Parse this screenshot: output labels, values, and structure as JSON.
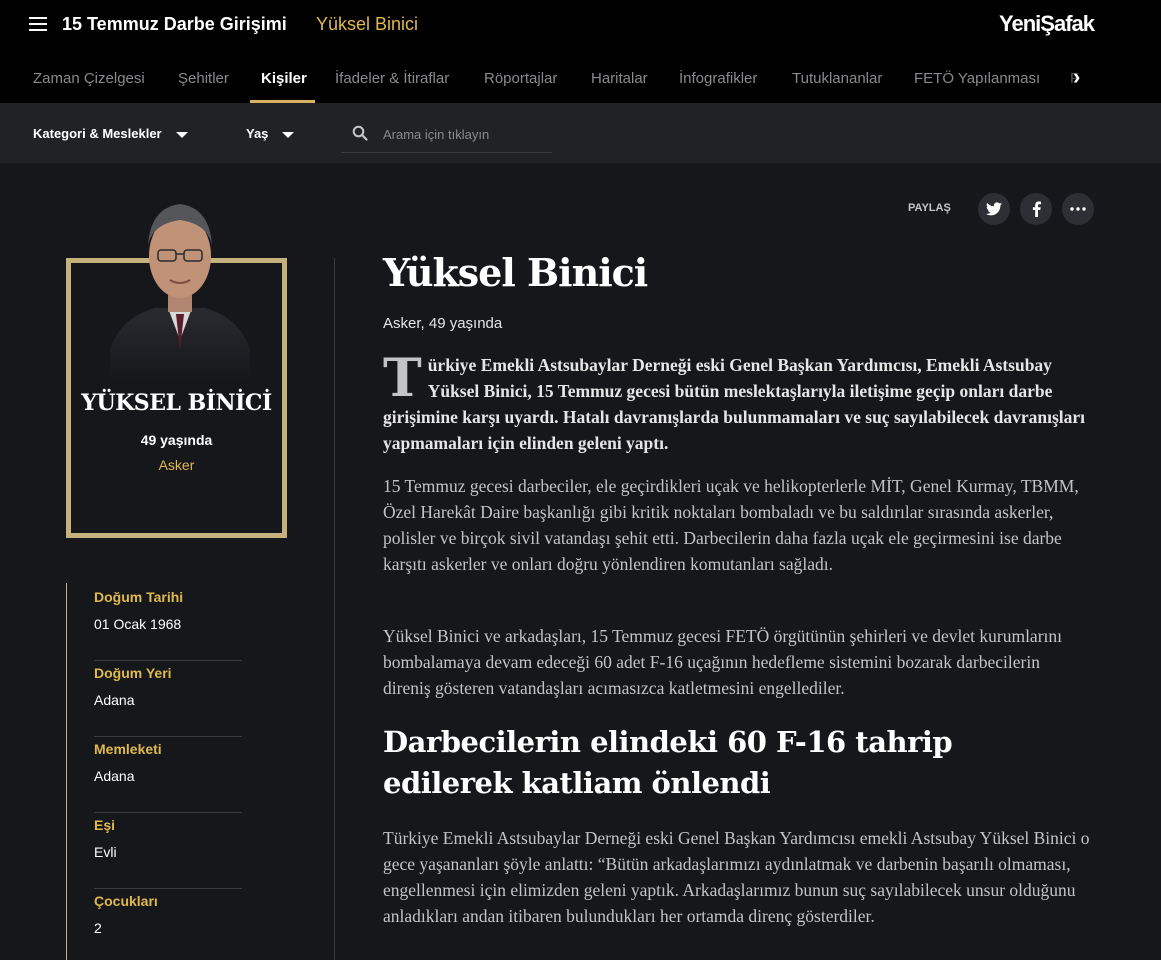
{
  "header": {
    "title": "15 Temmuz Darbe Girişimi",
    "subtitle": "Yüksel Binici",
    "logo": "YeniŞafak"
  },
  "nav": {
    "items": [
      "Zaman Çizelgesi",
      "Şehitler",
      "Kişiler",
      "İfadeler & İtiraflar",
      "Röportajlar",
      "Haritalar",
      "İnfografikler",
      "Tutuklananlar",
      "FETÖ Yapılanması",
      "F"
    ],
    "active": "Kişiler"
  },
  "filters": {
    "category": "Kategori & Meslekler",
    "age": "Yaş",
    "search_placeholder": "Arama için tıklayın"
  },
  "share": {
    "label": "PAYLAŞ"
  },
  "profile": {
    "name": "YÜKSEL BİNİCİ",
    "age": "49 yaşında",
    "job": "Asker",
    "facts": [
      {
        "label": "Doğum Tarihi",
        "value": "01 Ocak 1968"
      },
      {
        "label": "Doğum Yeri",
        "value": "Adana"
      },
      {
        "label": "Memleketi",
        "value": "Adana"
      },
      {
        "label": "Eşi",
        "value": "Evli"
      },
      {
        "label": "Çocukları",
        "value": "2"
      }
    ]
  },
  "article": {
    "title": "Yüksel Binici",
    "meta": "Asker, 49 yaşında",
    "dropcap": "T",
    "lead": "ürkiye Emekli Astsubaylar Derneği eski Genel Başkan Yardımcısı, Emekli Astsubay Yüksel Binici, 15 Temmuz gecesi bütün meslektaşlarıyla iletişime geçip onları darbe girişimine karşı uyardı. Hatalı davranışlarda bulunmamaları ve suç sayılabilecek davranışları yapmamaları için elinden geleni yaptı.",
    "p1": "15 Temmuz gecesi darbeciler, ele geçirdikleri uçak ve helikopterlerle MİT, Genel Kurmay, TBMM, Özel Harekât Daire başkanlığı gibi kritik noktaları bombaladı ve bu saldırılar sırasında askerler, polisler ve birçok sivil vatandaşı şehit etti. Darbecilerin daha fazla uçak ele geçirmesini ise darbe karşıtı askerler ve onları doğru yönlendiren komutanları sağladı.",
    "p2": "Yüksel Binici ve arkadaşları, 15 Temmuz gecesi FETÖ örgütünün şehirleri ve devlet kurumlarını bombalamaya devam edeceği 60 adet F-16 uçağının hedefleme sistemini bozarak darbecilerin direniş gösteren vatandaşları acımasızca katletmesini engellediler.",
    "subheading": "Darbecilerin elindeki 60 F-16 tahrip edilerek katliam önlendi",
    "p3": "Türkiye Emekli Astsubaylar Derneği eski Genel Başkan Yardımcısı emekli Astsubay Yüksel Binici o gece yaşananları şöyle anlattı: “Bütün arkadaşlarımızı aydınlatmak ve darbenin başarılı olmaması, engellenmesi için elimizden geleni yaptık. Arkadaşlarımız bunun suç sayılabilecek unsur olduğunu anladıkları andan itibaren bulundukları her ortamda direnç gösterdiler."
  }
}
